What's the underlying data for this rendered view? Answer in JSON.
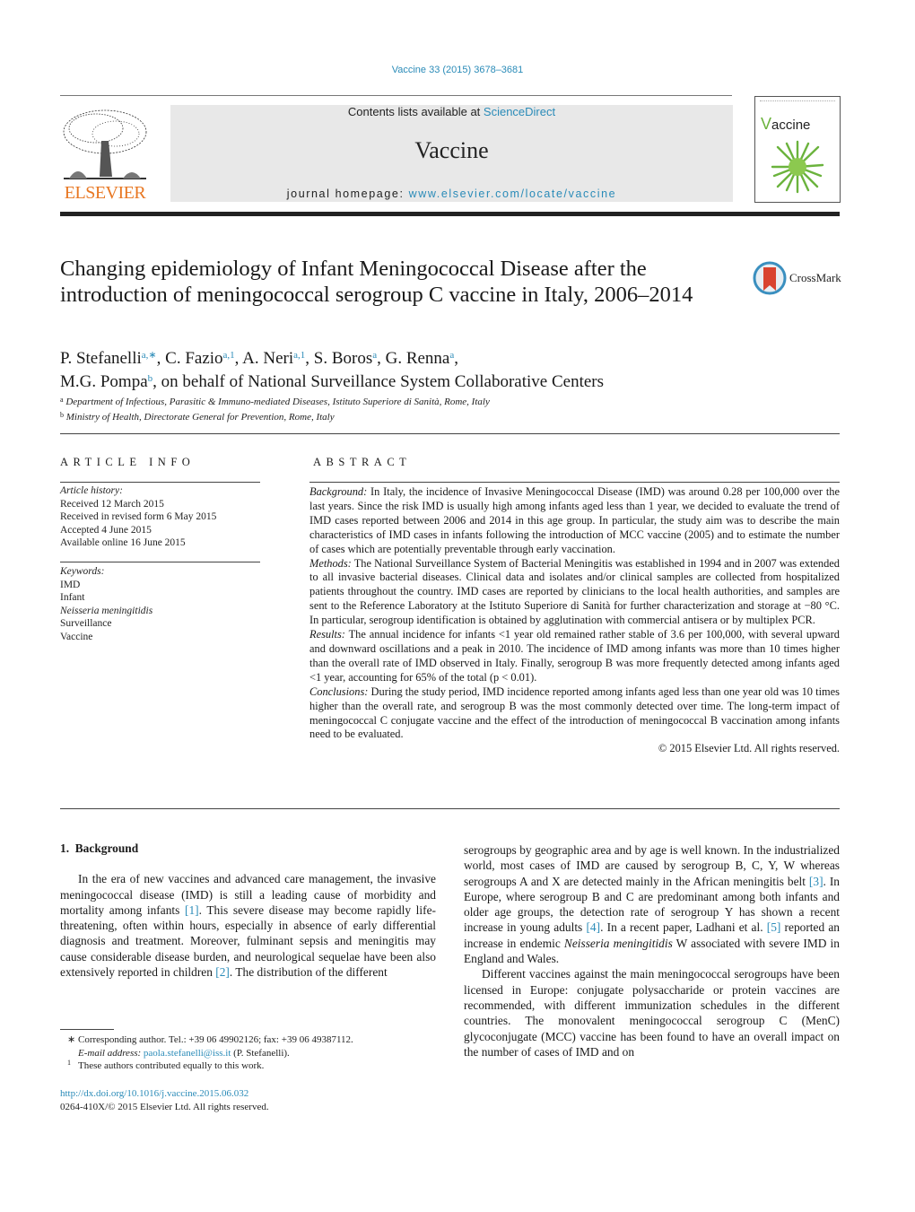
{
  "header": {
    "journal_ref": "Vaccine 33 (2015) 3678–3681",
    "contents_prefix": "Contents lists available at ",
    "contents_link": "ScienceDirect",
    "journal_name": "Vaccine",
    "homepage_prefix": "journal homepage: ",
    "homepage_link": "www.elsevier.com/locate/vaccine",
    "publisher_logo_text": "ELSEVIER",
    "cover_title_v": "V",
    "cover_title_rest": "accine",
    "crossmark_label": "CrossMark"
  },
  "colors": {
    "link": "#2a8bb8",
    "elsevier_orange": "#e87722",
    "header_box": "#e8e8e8",
    "cover_green": "#6bb33d",
    "crossmark_red": "#d9432f",
    "crossmark_blue": "#3a8fbf"
  },
  "article": {
    "title": "Changing epidemiology of Infant Meningococcal Disease after the introduction of meningococcal serogroup C vaccine in Italy, 2006–2014",
    "authors_line1": [
      {
        "name": "P. Stefanelli",
        "sup": "a,∗",
        "sep": ", "
      },
      {
        "name": "C. Fazio",
        "sup": "a,1",
        "sep": ", "
      },
      {
        "name": "A. Neri",
        "sup": "a,1",
        "sep": ", "
      },
      {
        "name": "S. Boros",
        "sup": "a",
        "sep": ", "
      },
      {
        "name": "G. Renna",
        "sup": "a",
        "sep": ","
      }
    ],
    "authors_line2": {
      "name": "M.G. Pompa",
      "sup": "b",
      "rest": ", on behalf of National Surveillance System Collaborative Centers"
    },
    "affiliations": [
      {
        "mark": "a",
        "text": "Department of Infectious, Parasitic & Immuno-mediated Diseases, Istituto Superiore di Sanità, Rome, Italy"
      },
      {
        "mark": "b",
        "text": "Ministry of Health, Directorate General for Prevention, Rome, Italy"
      }
    ]
  },
  "article_info": {
    "heading": "ARTICLE INFO",
    "history_label": "Article history:",
    "history": [
      "Received 12 March 2015",
      "Received in revised form 6 May 2015",
      "Accepted 4 June 2015",
      "Available online 16 June 2015"
    ],
    "keywords_label": "Keywords:",
    "keywords": [
      "IMD",
      "Infant",
      "Neisseria meningitidis",
      "Surveillance",
      "Vaccine"
    ]
  },
  "abstract": {
    "heading": "ABSTRACT",
    "sections": [
      {
        "label": "Background:",
        "text": " In Italy, the incidence of Invasive Meningococcal Disease (IMD) was around 0.28 per 100,000 over the last years. Since the risk IMD is usually high among infants aged less than 1 year, we decided to evaluate the trend of IMD cases reported between 2006 and 2014 in this age group. In particular, the study aim was to describe the main characteristics of IMD cases in infants following the introduction of MCC vaccine (2005) and to estimate the number of cases which are potentially preventable through early vaccination."
      },
      {
        "label": "Methods:",
        "text": " The National Surveillance System of Bacterial Meningitis was established in 1994 and in 2007 was extended to all invasive bacterial diseases. Clinical data and isolates and/or clinical samples are collected from hospitalized patients throughout the country. IMD cases are reported by clinicians to the local health authorities, and samples are sent to the Reference Laboratory at the Istituto Superiore di Sanità for further characterization and storage at −80 °C. In particular, serogroup identification is obtained by agglutination with commercial antisera or by multiplex PCR."
      },
      {
        "label": "Results:",
        "text": " The annual incidence for infants <1 year old remained rather stable of 3.6 per 100,000, with several upward and downward oscillations and a peak in 2010. The incidence of IMD among infants was more than 10 times higher than the overall rate of IMD observed in Italy. Finally, serogroup B was more frequently detected among infants aged <1 year, accounting for 65% of the total (p < 0.01)."
      },
      {
        "label": "Conclusions:",
        "text": " During the study period, IMD incidence reported among infants aged less than one year old was 10 times higher than the overall rate, and serogroup B was the most commonly detected over time. The long-term impact of meningococcal C conjugate vaccine and the effect of the introduction of meningococcal B vaccination among infants need to be evaluated."
      }
    ],
    "copyright": "© 2015 Elsevier Ltd. All rights reserved."
  },
  "body": {
    "section_number": "1.",
    "section_title": "Background",
    "left_para": [
      {
        "t": "In the era of new vaccines and advanced care management, the invasive meningococcal disease (IMD) is still a leading cause of morbidity and mortality among infants "
      },
      {
        "c": "[1]"
      },
      {
        "t": ". This severe disease may become rapidly life-threatening, often within hours, especially in absence of early differential diagnosis and treatment. Moreover, fulminant sepsis and meningitis may cause considerable disease burden, and neurological sequelae have been also extensively reported in children "
      },
      {
        "c": "[2]"
      },
      {
        "t": ". The distribution of the different"
      }
    ],
    "right_para1": [
      {
        "t": "serogroups by geographic area and by age is well known. In the industrialized world, most cases of IMD are caused by serogroup B, C, Y, W whereas serogroups A and X are detected mainly in the African meningitis belt "
      },
      {
        "c": "[3]"
      },
      {
        "t": ". In Europe, where serogroup B and C are predominant among both infants and older age groups, the detection rate of serogroup Y has shown a recent increase in young adults "
      },
      {
        "c": "[4]"
      },
      {
        "t": ". In a recent paper, Ladhani et al. "
      },
      {
        "c": "[5]"
      },
      {
        "t": " reported an increase in endemic "
      },
      {
        "i": "Neisseria meningitidis"
      },
      {
        "t": " W associated with severe IMD in England and Wales."
      }
    ],
    "right_para2": "Different vaccines against the main meningococcal serogroups have been licensed in Europe: conjugate polysaccharide or protein vaccines are recommended, with different immunization schedules in the different countries. The monovalent meningococcal serogroup C (MenC) glycoconjugate (MCC) vaccine has been found to have an overall impact on the number of cases of IMD and on"
  },
  "footnotes": {
    "corresponding_mark": "∗",
    "corresponding_text": "Corresponding author. Tel.: +39 06 49902126; fax: +39 06 49387112.",
    "email_label": "E-mail address:",
    "email": "paola.stefanelli@iss.it",
    "email_suffix": " (P. Stefanelli).",
    "equal_mark": "1",
    "equal_text": "These authors contributed equally to this work.",
    "doi": "http://dx.doi.org/10.1016/j.vaccine.2015.06.032",
    "issn_line": "0264-410X/© 2015 Elsevier Ltd. All rights reserved."
  }
}
